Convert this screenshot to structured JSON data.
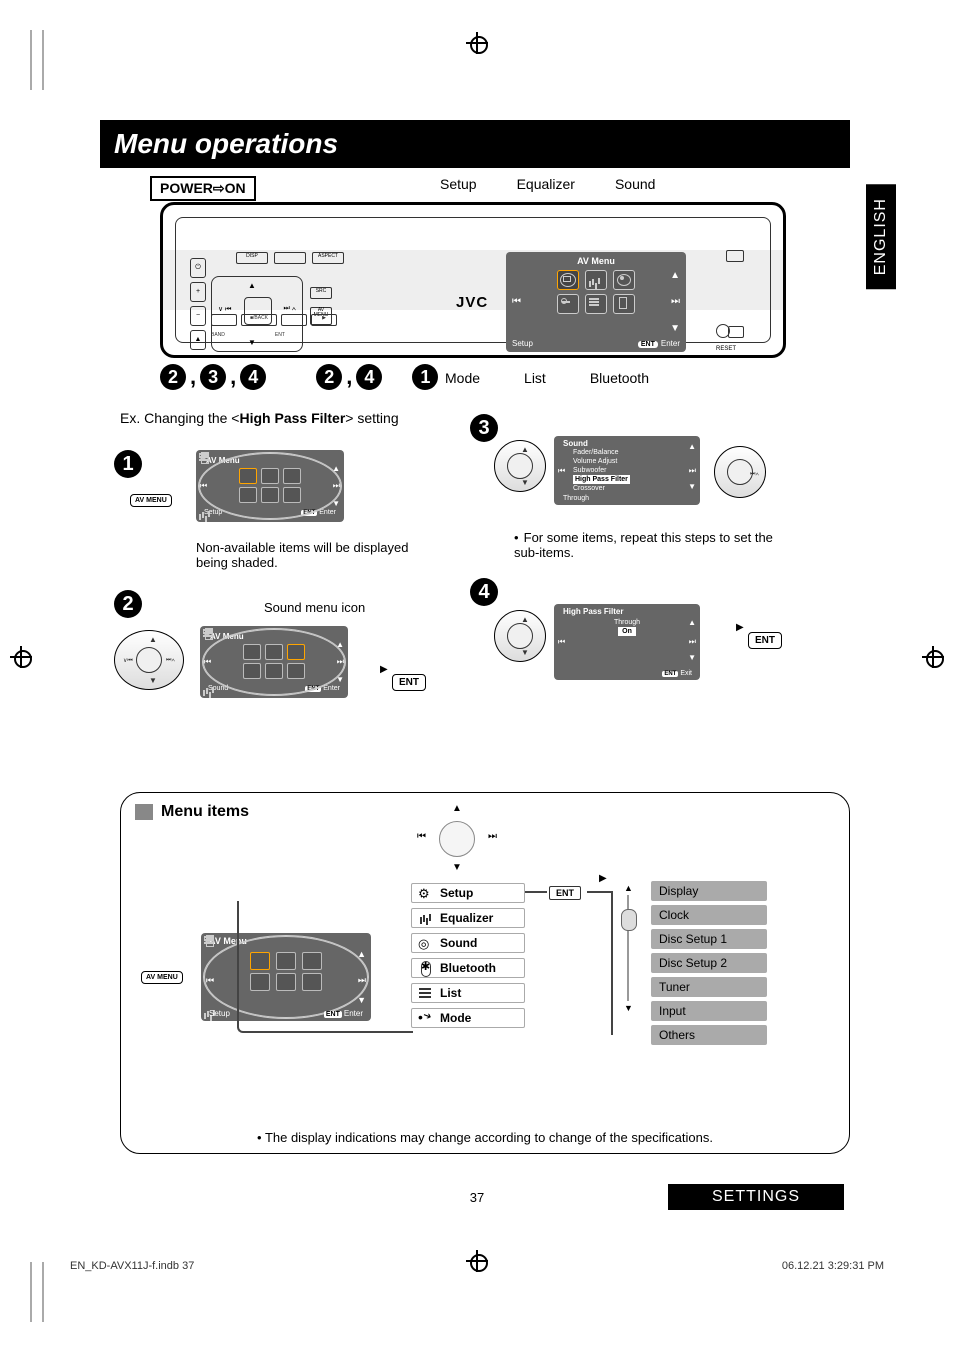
{
  "language_tab": "ENGLISH",
  "title": "Menu operations",
  "power_label": "POWER⇨ON",
  "top_icons": {
    "setup": "Setup",
    "equalizer": "Equalizer",
    "sound": "Sound"
  },
  "head_unit": {
    "brand": "JVC",
    "buttons_top": [
      "DISP",
      "",
      "ASPECT"
    ],
    "buttons_left": [
      "+",
      "−"
    ],
    "src_label": "SRC",
    "av_menu_label": "AV\nMENU",
    "bottom_buttons": [
      "",
      "■/BACK",
      "",
      ""
    ],
    "bottom_labels": [
      "BAND",
      "",
      "ENT"
    ],
    "reset_label": "RESET",
    "lcd": {
      "title": "AV Menu",
      "footer_left": "Setup",
      "footer_ent": "ENT",
      "footer_enter": "Enter"
    }
  },
  "step_row1": [
    "2",
    ",",
    "3",
    ",",
    "4"
  ],
  "step_row2": [
    "2",
    ",",
    "4"
  ],
  "step_row3": [
    "1"
  ],
  "bottom_icons": {
    "mode": "Mode",
    "list": "List",
    "bluetooth": "Bluetooth"
  },
  "example_prefix": "Ex. Changing the <",
  "example_bold": "High Pass Filter",
  "example_suffix": "> setting",
  "steps": {
    "s1": {
      "num": "1",
      "av_menu_btn": "AV\nMENU",
      "lcd_title": "AV Menu",
      "lcd_footer_left": "Setup",
      "lcd_ent": "ENT",
      "lcd_enter": "Enter",
      "note": "Non-available items will be displayed being shaded."
    },
    "s2": {
      "num": "2",
      "caption": "Sound menu icon",
      "lcd_title": "AV Menu",
      "lcd_footer_left": "Sound",
      "lcd_ent": "ENT",
      "lcd_enter": "Enter",
      "ent_btn": "ENT"
    },
    "s3": {
      "num": "3",
      "menu_title": "Sound",
      "items": [
        "Fader/Balance",
        "Volume Adjust",
        "Subwoofer",
        "High Pass Filter",
        "Crossover"
      ],
      "highlight_index": 3,
      "footer": "Through",
      "note": "For some items, repeat this steps to set the sub-items."
    },
    "s4": {
      "num": "4",
      "menu_title": "High Pass Filter",
      "opts": [
        "Through",
        "On"
      ],
      "highlight_index": 1,
      "exit_ent": "ENT",
      "exit_label": "Exit",
      "ent_btn": "ENT"
    }
  },
  "menu_items": {
    "header": "Menu items",
    "av_menu_btn": "AV\nMENU",
    "lcd_title": "AV Menu",
    "lcd_footer_left": "Setup",
    "lcd_ent": "ENT",
    "lcd_enter": "Enter",
    "categories": [
      "Setup",
      "Equalizer",
      "Sound",
      "Bluetooth",
      "List",
      "Mode"
    ],
    "ent_chip": "ENT",
    "sub_items": [
      "Display",
      "Clock",
      "Disc Setup 1",
      "Disc Setup 2",
      "Tuner",
      "Input",
      "Others"
    ],
    "footnote": "The display indications may change according to change of the specifications."
  },
  "page_number": "37",
  "settings_tab": "SETTINGS",
  "footer": {
    "left": "EN_KD-AVX11J-f.indb   37",
    "right": "06.12.21   3:29:31 PM"
  }
}
